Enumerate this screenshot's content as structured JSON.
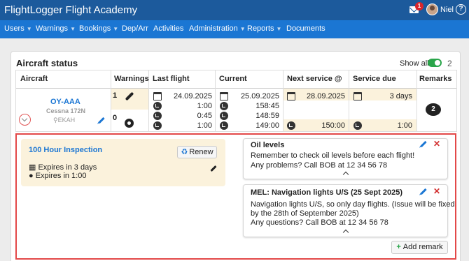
{
  "app": {
    "title": "FlightLogger Flight Academy",
    "notification_count": "1",
    "username": "Niel",
    "help_icon": "?"
  },
  "nav": [
    {
      "label": "Users",
      "has_caret": true
    },
    {
      "label": "Warnings",
      "has_caret": true
    },
    {
      "label": "Bookings",
      "has_caret": true
    },
    {
      "label": "Dep/Arr",
      "has_caret": false
    },
    {
      "label": "Activities",
      "has_caret": false
    },
    {
      "label": "Administration",
      "has_caret": true
    },
    {
      "label": "Reports",
      "has_caret": true
    },
    {
      "label": "Documents",
      "has_caret": false
    }
  ],
  "panel": {
    "title": "Aircraft status",
    "show_all_label": "Show all",
    "show_all_on": true,
    "count": "2"
  },
  "columns": [
    "Aircraft",
    "Warnings",
    "Last flight",
    "Current",
    "Next service @",
    "Service due",
    "Remarks"
  ],
  "aircraft": {
    "registration": "OY-AAA",
    "model": "Cessna 172N",
    "base": "EKAH",
    "warnings": [
      {
        "count": "1",
        "icon": "wrench-icon"
      },
      {
        "count": "0",
        "icon": "tyre-icon"
      }
    ],
    "last_flight": [
      "24.09.2025",
      "1:00",
      "0:45",
      "1:00"
    ],
    "current": [
      "25.09.2025",
      "158:45",
      "148:59",
      "149:00"
    ],
    "next_service": [
      "28.09.2025",
      "150:00"
    ],
    "service_due": [
      "3 days",
      "1:00"
    ],
    "remarks_count": "2"
  },
  "inspection": {
    "title": "100 Hour Inspection",
    "renew_label": "Renew",
    "expires_days": "Expires in 3 days",
    "expires_hours": "Expires in 1:00"
  },
  "remarks": [
    {
      "title": "Oil levels",
      "lines": [
        "Remember to check oil levels before each flight!",
        "Any problems? Call BOB at 12 34 56 78"
      ]
    },
    {
      "title": "MEL: Navigation lights U/S (25 Sept 2025)",
      "lines": [
        "Navigation lights U/S, so only day flights. (Issue will be fixed",
        "by the 28th of September 2025)",
        "Any questions? Call BOB at 12 34 56 78"
      ]
    }
  ],
  "add_remark_label": "Add remark",
  "colors": {
    "topbar": "#1c5a9c",
    "navbar": "#1b76d3",
    "accent": "#1b76d3",
    "highlight": "#fbf2dc",
    "danger": "#e34848",
    "toggle": "#2aa54a"
  }
}
